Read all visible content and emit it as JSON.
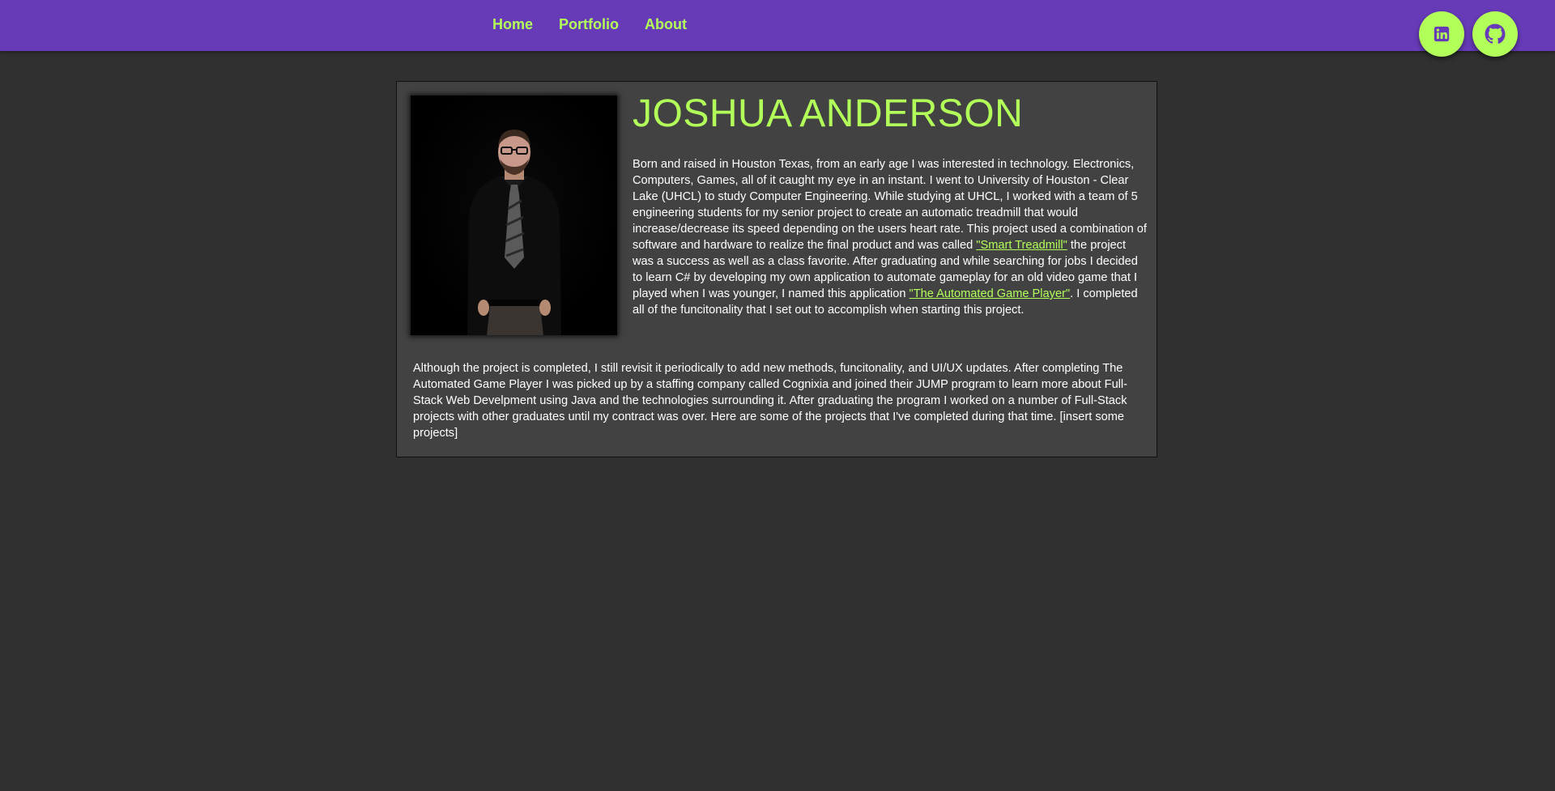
{
  "nav": {
    "home": "Home",
    "portfolio": "Portfolio",
    "about": "About"
  },
  "social": {
    "linkedin_icon": "linkedin-icon",
    "github_icon": "github-icon"
  },
  "profile": {
    "name": "JOSHUA ANDERSON",
    "photo_alt": "portrait-photo",
    "para1_part1": "Born and raised in Houston Texas, from an early age I was interested in technology. Electronics, Computers, Games, all of it caught my eye in an instant. I went to University of Houston - Clear Lake (UHCL) to study Computer Engineering. While studying at UHCL, I worked with a team of 5 engineering students for my senior project to create an automatic treadmill that would increase/decrease its speed depending on the users heart rate. This project used a combination of software and hardware to realize the final product and was called ",
    "smart_treadmill_link": "\"Smart Treadmill\"",
    "para1_part2": " the project was a success as well as a class favorite. After graduating and while searching for jobs I decided to learn C# by developing my own application to automate gameplay for an old video game that I played when I was younger, I named this application ",
    "game_player_link": "\"The Automated Game Player\"",
    "para1_part3": ". I completed all of the funcitonality that I set out to accomplish when starting this project.",
    "para2": "Although the project is completed, I still revisit it periodically to add new methods, funcitonality, and UI/UX updates. After completing The Automated Game Player I was picked up by a staffing company called Cognixia and joined their JUMP program to learn more about Full-Stack Web Develpment using Java and the technologies surrounding it. After graduating the program I worked on a number of Full-Stack projects with other graduates until my contract was over. Here are some of the projects that I've completed during that time. [insert some projects]"
  },
  "colors": {
    "header_bg": "#673ab7",
    "accent": "#b2ff59",
    "page_bg": "#303030",
    "card_bg": "#424242"
  }
}
